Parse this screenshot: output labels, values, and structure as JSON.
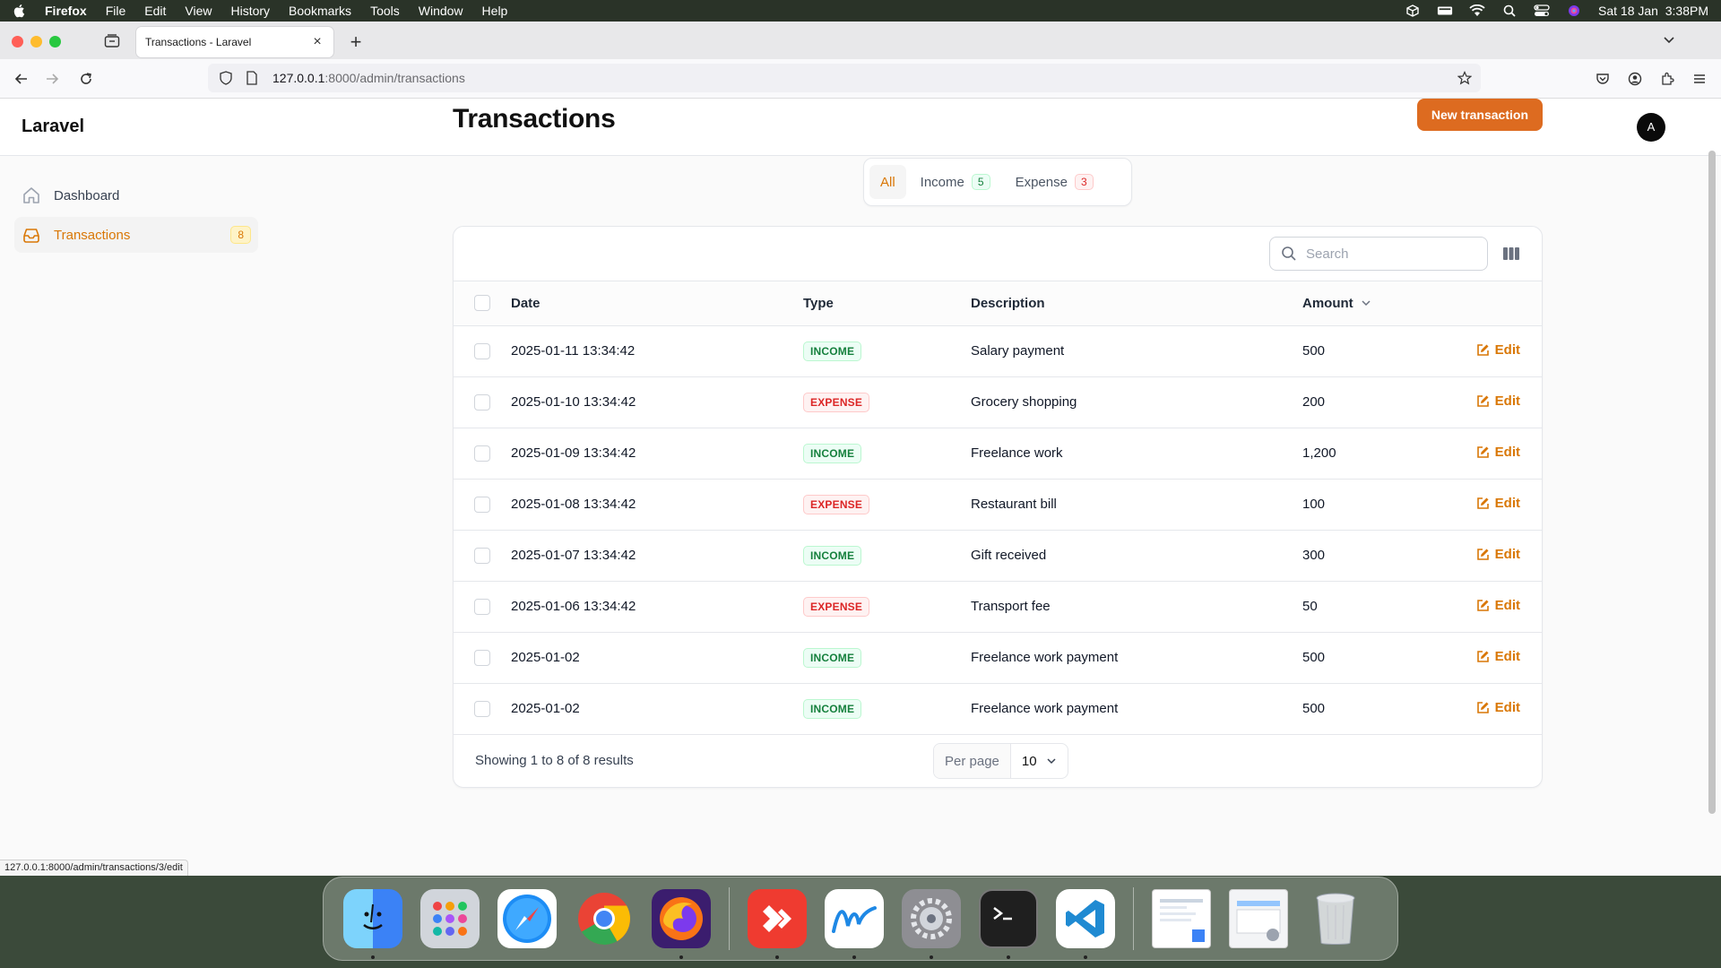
{
  "menubar": {
    "app_name": "Firefox",
    "menus": [
      "File",
      "Edit",
      "View",
      "History",
      "Bookmarks",
      "Tools",
      "Window",
      "Help"
    ],
    "clock": "Sat 18 Jan  3:38PM"
  },
  "browser": {
    "tab_title": "Transactions - Laravel",
    "url_host": "127.0.0.1",
    "url_path": ":8000/admin/transactions",
    "status_url": "127.0.0.1:8000/admin/transactions/3/edit"
  },
  "app": {
    "brand": "Laravel",
    "avatar_initial": "A"
  },
  "sidebar": {
    "items": [
      {
        "label": "Dashboard",
        "icon": "home-icon"
      },
      {
        "label": "Transactions",
        "icon": "inbox-icon",
        "badge": "8"
      }
    ]
  },
  "main": {
    "title": "Transactions",
    "new_button": "New transaction",
    "tabs": [
      {
        "label": "All"
      },
      {
        "label": "Income",
        "count": "5"
      },
      {
        "label": "Expense",
        "count": "3"
      }
    ],
    "search_placeholder": "Search",
    "columns": {
      "date": "Date",
      "type": "Type",
      "description": "Description",
      "amount": "Amount"
    },
    "edit_label": "Edit",
    "rows": [
      {
        "date": "2025-01-11 13:34:42",
        "type": "INCOME",
        "description": "Salary payment",
        "amount": "500"
      },
      {
        "date": "2025-01-10 13:34:42",
        "type": "EXPENSE",
        "description": "Grocery shopping",
        "amount": "200"
      },
      {
        "date": "2025-01-09 13:34:42",
        "type": "INCOME",
        "description": "Freelance work",
        "amount": "1,200"
      },
      {
        "date": "2025-01-08 13:34:42",
        "type": "EXPENSE",
        "description": "Restaurant bill",
        "amount": "100"
      },
      {
        "date": "2025-01-07 13:34:42",
        "type": "INCOME",
        "description": "Gift received",
        "amount": "300"
      },
      {
        "date": "2025-01-06 13:34:42",
        "type": "EXPENSE",
        "description": "Transport fee",
        "amount": "50"
      },
      {
        "date": "2025-01-02",
        "type": "INCOME",
        "description": "Freelance work payment",
        "amount": "500"
      },
      {
        "date": "2025-01-02",
        "type": "INCOME",
        "description": "Freelance work payment",
        "amount": "500"
      }
    ],
    "showing": "Showing 1 to 8 of 8 results",
    "per_page_label": "Per page",
    "per_page_value": "10"
  },
  "colors": {
    "accent": "#dd6b20",
    "income": "#15803d",
    "expense": "#dc2626"
  },
  "dock": {
    "apps": [
      "Finder",
      "Launchpad",
      "Safari",
      "Chrome",
      "Firefox",
      "AnyDesk",
      "Freeform",
      "System Settings",
      "Terminal",
      "Visual Studio Code",
      "Preview window",
      "Finder window",
      "Trash"
    ]
  }
}
